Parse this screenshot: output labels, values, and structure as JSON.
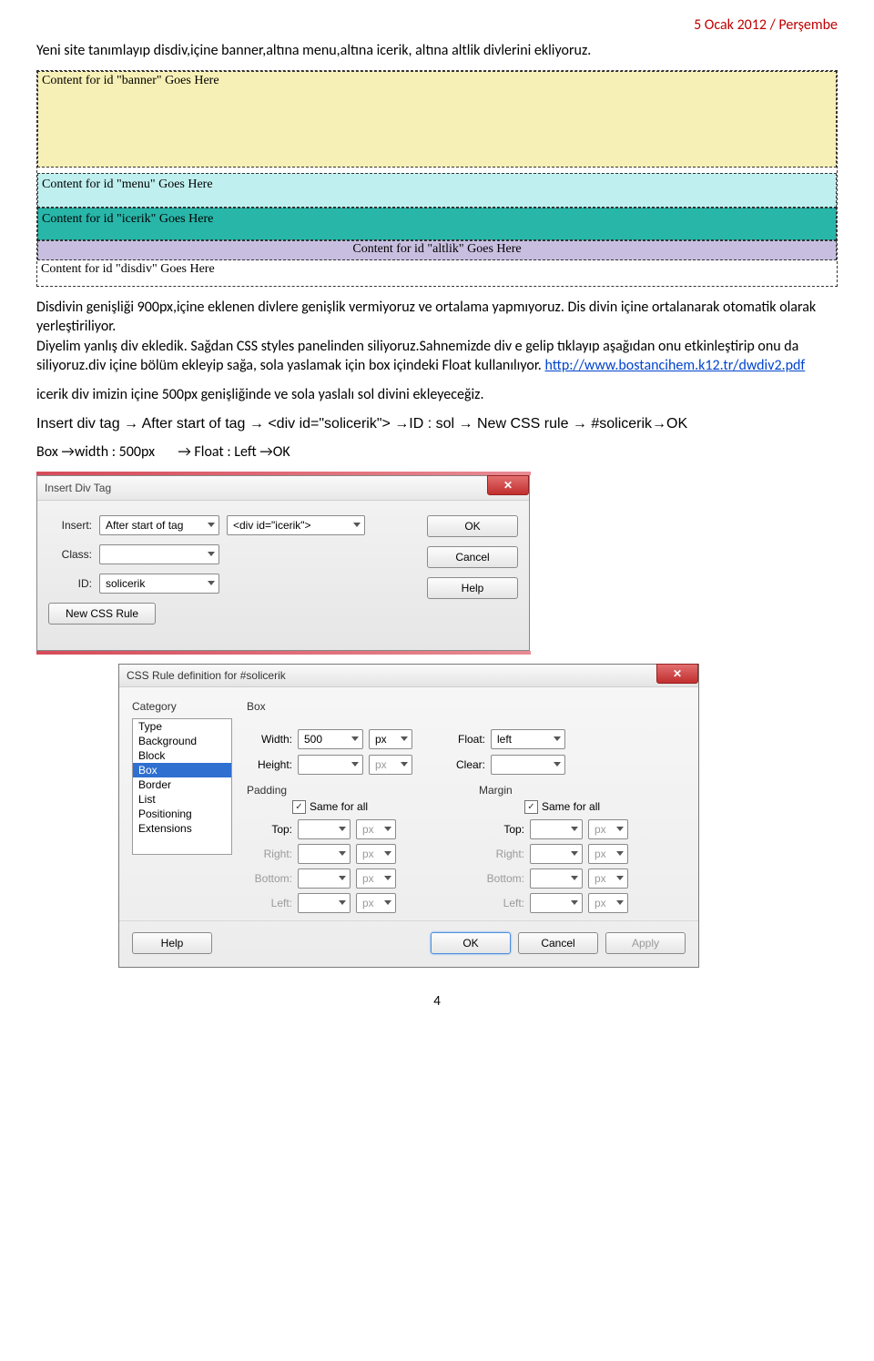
{
  "header": {
    "date": "5 Ocak 2012 / Perşembe"
  },
  "intro": "Yeni site tanımlayıp disdiv,içine banner,altına menu,altına icerik, altına altlik divlerini ekliyoruz.",
  "dw": {
    "banner": "Content for id \"banner\" Goes Here",
    "menu": "Content for id \"menu\" Goes Here",
    "icerik": "Content for id \"icerik\" Goes Here",
    "altlik": "Content for id \"altlik\" Goes Here",
    "disdiv": "Content for id \"disdiv\" Goes Here"
  },
  "para2a": "Disdivin genişliği 900px,içine eklenen divlere genişlik vermiyoruz ve ortalama yapmıyoruz. Dis divin içine ortalanarak otomatik olarak yerleştiriliyor.",
  "para2b": "Diyelim yanlış div ekledik. Sağdan CSS styles panelinden siliyoruz.Sahnemizde div e gelip tıklayıp aşağıdan onu etkinleştirip onu da siliyoruz.div içine bölüm ekleyip sağa, sola yaslamak için box içindeki Float kullanılıyor. ",
  "link": "http://www.bostancihem.k12.tr/dwdiv2.pdf",
  "para3": "icerik div imizin içine 500px genişliğinde ve sola yaslalı sol divini ekleyeceğiz.",
  "para4": "Insert div tag → After start of tag → <div id=\"solicerik\"> →ID : sol → New CSS rule → #solicerik→OK",
  "para5a": "Box →width : 500px",
  "para5b": "→  Float : Left  →OK",
  "dialog1": {
    "title": "Insert Div Tag",
    "insertLabel": "Insert:",
    "insertMode": "After start of tag",
    "insertTarget": "<div id=\"icerik\">",
    "classLabel": "Class:",
    "classValue": "",
    "idLabel": "ID:",
    "idValue": "solicerik",
    "newRule": "New CSS Rule",
    "ok": "OK",
    "cancel": "Cancel",
    "help": "Help"
  },
  "dialog2": {
    "title": "CSS Rule definition for #solicerik",
    "catLabel": "Category",
    "categories": [
      "Type",
      "Background",
      "Block",
      "Box",
      "Border",
      "List",
      "Positioning",
      "Extensions"
    ],
    "selectedCategory": "Box",
    "boxHeading": "Box",
    "widthLabel": "Width:",
    "widthVal": "500",
    "pxUnit": "px",
    "heightLabel": "Height:",
    "heightVal": "",
    "floatLabel": "Float:",
    "floatVal": "left",
    "clearLabel": "Clear:",
    "clearVal": "",
    "paddingLabel": "Padding",
    "marginLabel": "Margin",
    "sameAll": "Same for all",
    "sides": {
      "top": "Top:",
      "right": "Right:",
      "bottom": "Bottom:",
      "left": "Left:"
    },
    "help": "Help",
    "ok": "OK",
    "cancel": "Cancel",
    "apply": "Apply"
  },
  "page_number": "4"
}
